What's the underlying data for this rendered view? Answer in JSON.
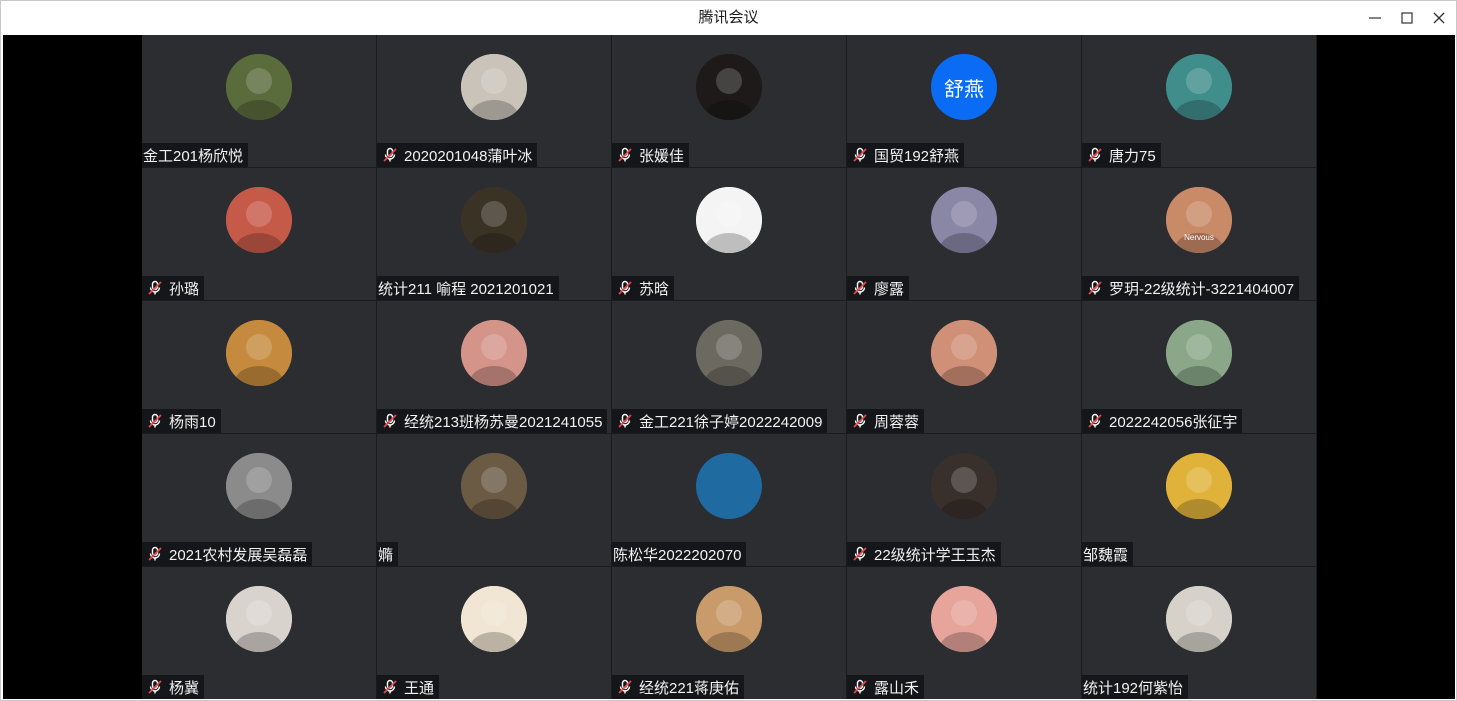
{
  "window": {
    "title": "腾讯会议"
  },
  "colors": {
    "tile_bg": "#2b2d31",
    "stage_bg": "#000000",
    "mute_red": "#e5484d",
    "initials_avatar_blue": "#0a6cf5",
    "empty_avatar_blue": "#1f6aa1"
  },
  "participants": [
    {
      "name": "金工201杨欣悦",
      "muted": false,
      "avatar": "photo-avatar",
      "tone": "#5a6b3c"
    },
    {
      "name": "2020201048蒲叶冰",
      "muted": true,
      "avatar": "photo-avatar",
      "tone": "#c9c3b9"
    },
    {
      "name": "张媛佳",
      "muted": true,
      "avatar": "photo-avatar",
      "tone": "#1e1a1a"
    },
    {
      "name": "国贸192舒燕",
      "muted": true,
      "avatar": "initials-avatar",
      "initials": "舒燕",
      "tone": "#0a6cf5"
    },
    {
      "name": "唐力75",
      "muted": true,
      "avatar": "photo-avatar",
      "tone": "#3f8e8c"
    },
    {
      "name": "孙璐",
      "muted": true,
      "avatar": "photo-avatar",
      "tone": "#c65a49"
    },
    {
      "name": "统计211 喻程 2021201021",
      "muted": false,
      "avatar": "photo-avatar",
      "tone": "#3b3226"
    },
    {
      "name": "苏晗",
      "muted": true,
      "avatar": "photo-avatar",
      "tone": "#f4f4f4"
    },
    {
      "name": "廖露",
      "muted": true,
      "avatar": "photo-avatar",
      "tone": "#8a86a6"
    },
    {
      "name": "罗玥-22级统计-3221404007",
      "muted": true,
      "avatar": "photo-avatar",
      "badge": "Nervous",
      "tone": "#c98a68"
    },
    {
      "name": "杨雨10",
      "muted": true,
      "avatar": "photo-avatar",
      "tone": "#c58a3d"
    },
    {
      "name": "经统213班杨苏曼2021241055",
      "muted": true,
      "avatar": "photo-avatar",
      "tone": "#d4948a"
    },
    {
      "name": "金工221徐子婷2022242009",
      "muted": true,
      "avatar": "photo-avatar",
      "tone": "#6c6a60"
    },
    {
      "name": "周蓉蓉",
      "muted": true,
      "avatar": "photo-avatar",
      "tone": "#d08f77"
    },
    {
      "name": "2022242056张征宇",
      "muted": true,
      "avatar": "photo-avatar",
      "tone": "#8aa78a"
    },
    {
      "name": "2021农村发展吴磊磊",
      "muted": true,
      "avatar": "photo-avatar",
      "tone": "#8b8b8b"
    },
    {
      "name": "嫷",
      "muted": false,
      "avatar": "photo-avatar",
      "tone": "#6b5a44"
    },
    {
      "name": "陈松华2022202070",
      "muted": false,
      "avatar": "empty-avatar",
      "tone": "#1f6aa1"
    },
    {
      "name": "22级统计学王玉杰",
      "muted": true,
      "avatar": "photo-avatar",
      "tone": "#3a302b"
    },
    {
      "name": "邹魏霞",
      "muted": false,
      "avatar": "photo-avatar",
      "tone": "#e0b23a"
    },
    {
      "name": "杨冀",
      "muted": true,
      "avatar": "photo-avatar",
      "tone": "#d9d3cd"
    },
    {
      "name": "王通",
      "muted": true,
      "avatar": "photo-avatar",
      "tone": "#f1e5d3"
    },
    {
      "name": "经统221蒋庚佑",
      "muted": true,
      "avatar": "photo-avatar",
      "tone": "#c99b6b"
    },
    {
      "name": "露山禾",
      "muted": true,
      "avatar": "photo-avatar",
      "tone": "#e6a49b"
    },
    {
      "name": "统计192何紫怡",
      "muted": false,
      "avatar": "photo-avatar",
      "tone": "#d6d2ca"
    }
  ]
}
